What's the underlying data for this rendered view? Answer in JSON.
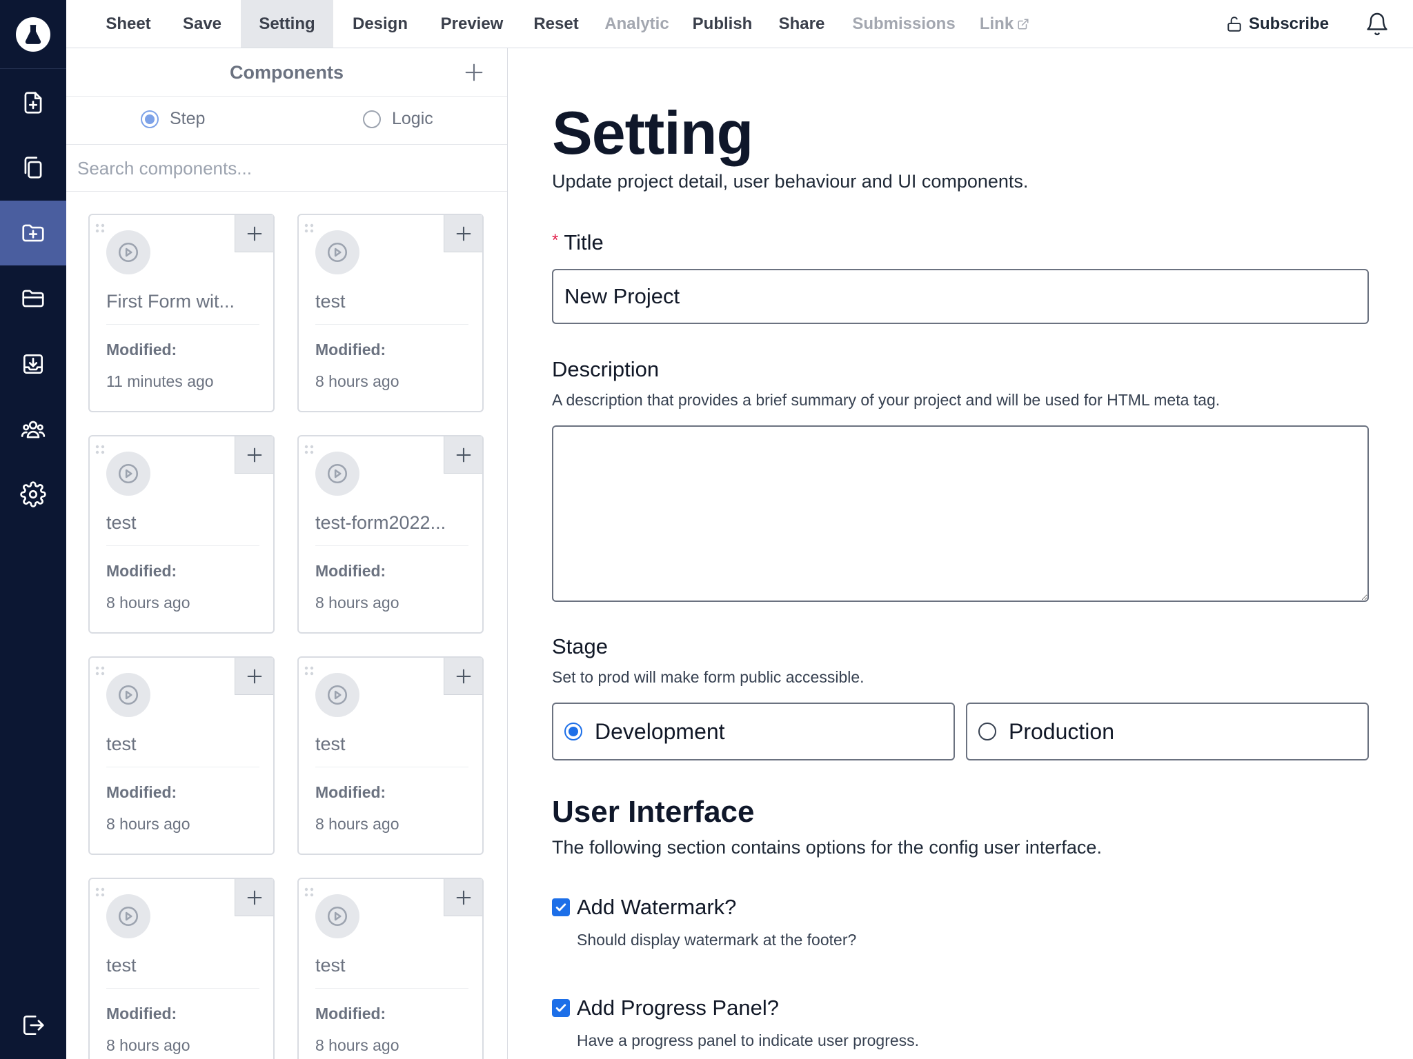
{
  "nav_rail": {
    "items": [
      {
        "icon": "file-plus-icon"
      },
      {
        "icon": "copy-icon"
      },
      {
        "icon": "folder-plus-icon",
        "active": true
      },
      {
        "icon": "folder-open-icon"
      },
      {
        "icon": "inbox-download-icon"
      },
      {
        "icon": "users-icon"
      },
      {
        "icon": "gear-icon"
      }
    ],
    "logout_icon": "logout-icon",
    "logo_icon": "flask-icon"
  },
  "menu": {
    "items": [
      {
        "label": "Sheet"
      },
      {
        "label": "Save"
      },
      {
        "label": "Setting",
        "active": true
      },
      {
        "label": "Design"
      },
      {
        "label": "Preview"
      },
      {
        "label": "Reset"
      },
      {
        "label": "Analytic",
        "disabled": true
      },
      {
        "label": "Publish"
      },
      {
        "label": "Share"
      },
      {
        "label": "Submissions",
        "disabled": true
      },
      {
        "label": "Link",
        "disabled": true
      }
    ],
    "subscribe_label": "Subscribe"
  },
  "components_panel": {
    "title": "Components",
    "modes": [
      {
        "label": "Step",
        "selected": true
      },
      {
        "label": "Logic",
        "selected": false
      }
    ],
    "search_placeholder": "Search components...",
    "modified_label": "Modified:",
    "cards": [
      {
        "name": "First Form wit...",
        "modified": "11 minutes ago"
      },
      {
        "name": "test",
        "modified": "8 hours ago"
      },
      {
        "name": "test",
        "modified": "8 hours ago"
      },
      {
        "name": "test-form2022...",
        "modified": "8 hours ago"
      },
      {
        "name": "test",
        "modified": "8 hours ago"
      },
      {
        "name": "test",
        "modified": "8 hours ago"
      },
      {
        "name": "test",
        "modified": "8 hours ago"
      },
      {
        "name": "test",
        "modified": "8 hours ago"
      }
    ]
  },
  "settings": {
    "heading": "Setting",
    "subheading": "Update project detail, user behaviour and UI components.",
    "title_field": {
      "required_mark": "*",
      "label": "Title",
      "value": "New Project"
    },
    "description_field": {
      "label": "Description",
      "hint": "A description that provides a brief summary of your project and will be used for HTML meta tag.",
      "value": ""
    },
    "stage": {
      "label": "Stage",
      "hint": "Set to prod will make form public accessible.",
      "options": [
        {
          "label": "Development",
          "selected": true
        },
        {
          "label": "Production",
          "selected": false
        }
      ]
    },
    "ui_section": {
      "heading": "User Interface",
      "subheading": "The following section contains options for the config user interface.",
      "options": [
        {
          "label": "Add Watermark?",
          "hint": "Should display watermark at the footer?",
          "checked": true
        },
        {
          "label": "Add Progress Panel?",
          "hint": "Have a progress panel to indicate user progress.",
          "checked": true
        }
      ]
    }
  },
  "colors": {
    "rail_bg": "#0c1733",
    "rail_active": "#4a5e9f",
    "accent": "#1d6fe8",
    "required": "#e11d48"
  }
}
